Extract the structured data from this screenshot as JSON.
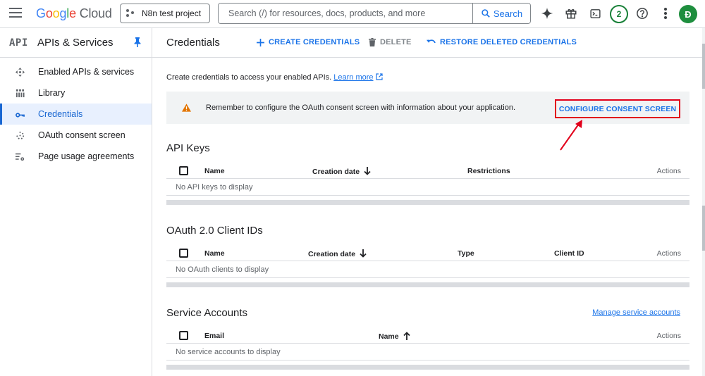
{
  "colors": {
    "accent": "#1a73e8",
    "active_bg": "#e8f0fe",
    "warning": "#e37400",
    "highlight_red": "#e2001a",
    "badge_green": "#188038"
  },
  "header": {
    "logo_google": [
      "G",
      "o",
      "o",
      "g",
      "l",
      "e"
    ],
    "logo_cloud": "Cloud",
    "project_name": "N8n test project",
    "search_placeholder": "Search (/) for resources, docs, products, and more",
    "search_button": "Search",
    "notification_count": "2",
    "avatar_initial": "Đ",
    "icons": [
      "menu-icon",
      "spark-icon",
      "gift-icon",
      "terminal-icon",
      "help-icon",
      "more-vert-icon"
    ]
  },
  "sidebar": {
    "mark": "API",
    "title": "APIs & Services",
    "items": [
      {
        "label": "Enabled APIs & services",
        "icon": "apis-icon"
      },
      {
        "label": "Library",
        "icon": "library-icon"
      },
      {
        "label": "Credentials",
        "icon": "key-icon",
        "active": true
      },
      {
        "label": "OAuth consent screen",
        "icon": "consent-icon"
      },
      {
        "label": "Page usage agreements",
        "icon": "settings-list-icon"
      }
    ]
  },
  "main": {
    "title": "Credentials",
    "toolbar": {
      "create": "CREATE CREDENTIALS",
      "delete": "DELETE",
      "restore": "RESTORE DELETED CREDENTIALS"
    },
    "intro_text": "Create credentials to access your enabled APIs.",
    "learn_more": "Learn more",
    "banner_text": "Remember to configure the OAuth consent screen with information about your application.",
    "consent_button": "CONFIGURE CONSENT SCREEN",
    "api_keys": {
      "title": "API Keys",
      "columns": [
        "Name",
        "Creation date",
        "Restrictions",
        "Actions"
      ],
      "empty": "No API keys to display"
    },
    "oauth": {
      "title": "OAuth 2.0 Client IDs",
      "columns": [
        "Name",
        "Creation date",
        "Type",
        "Client ID",
        "Actions"
      ],
      "empty": "No OAuth clients to display"
    },
    "service_accounts": {
      "title": "Service Accounts",
      "manage_link": "Manage service accounts",
      "columns": [
        "Email",
        "Name",
        "Actions"
      ],
      "empty": "No service accounts to display"
    }
  }
}
